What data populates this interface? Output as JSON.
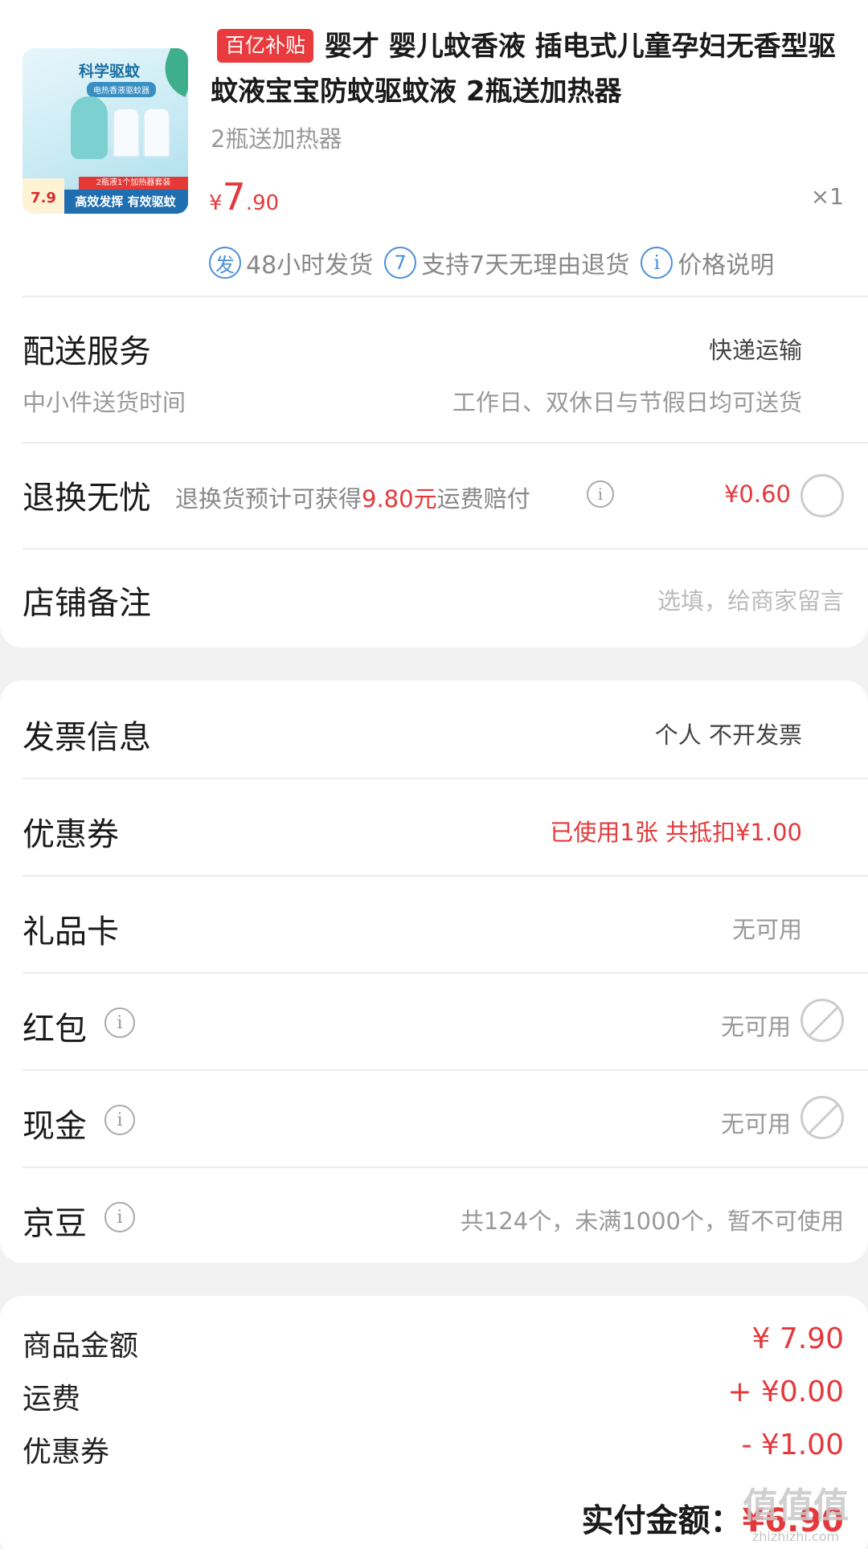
{
  "product": {
    "image_title": "科学驱蚊",
    "image_sub": "电热香液驱蚊器",
    "image_red_band": "2瓶液1个加热器套装",
    "image_blue_band": "高效发挥 有效驱蚊",
    "image_price": "7.9",
    "subsidy_tag": "百亿补贴",
    "title": "婴才 婴儿蚊香液 插电式儿童孕妇无香型驱蚊液宝宝防蚊驱蚊液 2瓶送加热器",
    "spec": "2瓶送加热器",
    "price_currency": "¥",
    "price_int": "7",
    "price_dec": ".90",
    "qty": "×1",
    "services": [
      {
        "icon": "发",
        "label": "48小时发货"
      },
      {
        "icon": "7",
        "label": "支持7天无理由退货"
      },
      {
        "icon": "i",
        "label": "价格说明"
      }
    ]
  },
  "delivery": {
    "label": "配送服务",
    "value": "快递运输",
    "sub_label": "中小件送货时间",
    "sub_value": "工作日、双休日与节假日均可送货"
  },
  "return": {
    "label": "退换无忧",
    "desc_prefix": "退换货预计可获得",
    "desc_amount": "9.80元",
    "desc_suffix": "运费赔付",
    "price": "¥0.60"
  },
  "note": {
    "label": "店铺备注",
    "placeholder": "选填，给商家留言"
  },
  "invoice": {
    "label": "发票信息",
    "value": "个人 不开发票"
  },
  "coupon": {
    "label": "优惠券",
    "value": "已使用1张 共抵扣¥1.00"
  },
  "giftcard": {
    "label": "礼品卡",
    "value": "无可用"
  },
  "redpacket": {
    "label": "红包",
    "value": "无可用"
  },
  "cash": {
    "label": "现金",
    "value": "无可用"
  },
  "jingdou": {
    "label": "京豆",
    "value": "共124个，未满1000个，暂不可使用"
  },
  "summary": {
    "goods_label": "商品金额",
    "goods_value": "¥ 7.90",
    "freight_label": "运费",
    "freight_value": "+ ¥0.00",
    "coupon_label": "优惠券",
    "coupon_value": "- ¥1.00",
    "total_label": "实付金额：",
    "total_value": "¥6.90"
  },
  "watermark": {
    "main": "值值值",
    "sub": "zhizhizhi.com"
  },
  "colors": {
    "accent_red": "#e4393c",
    "service_blue": "#4a90d9",
    "background": "#f2f2f2"
  }
}
